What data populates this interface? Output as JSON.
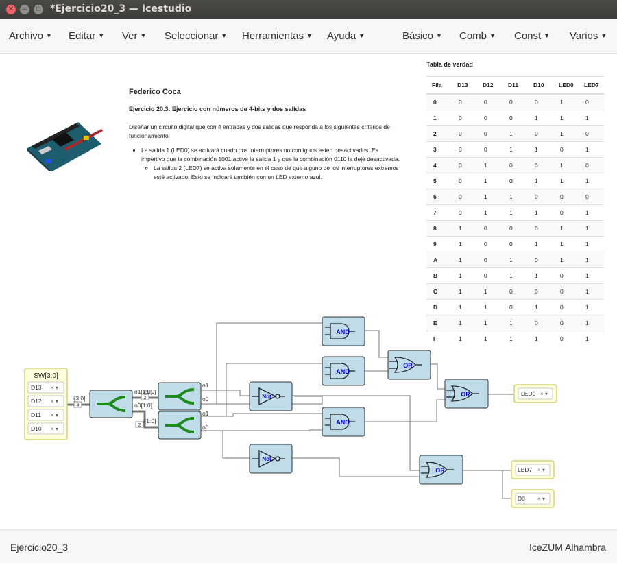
{
  "window": {
    "title": "*Ejercicio20_3 — Icestudio"
  },
  "menu": {
    "left": [
      "Archivo",
      "Editar",
      "Ver",
      "Seleccionar",
      "Herramientas",
      "Ayuda"
    ],
    "right": [
      "Básico",
      "Comb",
      "Const",
      "Varios"
    ]
  },
  "doc": {
    "author": "Federico Coca",
    "subtitle": "Ejercicio 20.3: Ejercicio con números de 4-bits y dos salidas",
    "intro": "Diseñar un circuito digital que con 4 entradas y dos salidas que responda a los siguientes criterios de funcionamiento:",
    "item1": "La salida 1 (LED0) se activará cuado dos interruptores no contiguos estén desactivados. Es impertivo que la combinación 1001 active la salida 1 y que la combinación 0110 la deje desactivada.",
    "item2": "La salida 2 (LED7) se activa solamente en el caso de que alguno de los interruptores extremos esté activado. Esto se indicará también con un LED externo azul."
  },
  "truth_table": {
    "title": "Tabla de verdad",
    "headers": [
      "Fila",
      "D13",
      "D12",
      "D11",
      "D10",
      "LED0",
      "LED7"
    ],
    "rows": [
      [
        "0",
        "0",
        "0",
        "0",
        "0",
        "1",
        "0"
      ],
      [
        "1",
        "0",
        "0",
        "0",
        "1",
        "1",
        "1"
      ],
      [
        "2",
        "0",
        "0",
        "1",
        "0",
        "1",
        "0"
      ],
      [
        "3",
        "0",
        "0",
        "1",
        "1",
        "0",
        "1"
      ],
      [
        "4",
        "0",
        "1",
        "0",
        "0",
        "1",
        "0"
      ],
      [
        "5",
        "0",
        "1",
        "0",
        "1",
        "1",
        "1"
      ],
      [
        "6",
        "0",
        "1",
        "1",
        "0",
        "0",
        "0"
      ],
      [
        "7",
        "0",
        "1",
        "1",
        "1",
        "0",
        "1"
      ],
      [
        "8",
        "1",
        "0",
        "0",
        "0",
        "1",
        "1"
      ],
      [
        "9",
        "1",
        "0",
        "0",
        "1",
        "1",
        "1"
      ],
      [
        "A",
        "1",
        "0",
        "1",
        "0",
        "1",
        "1"
      ],
      [
        "B",
        "1",
        "0",
        "1",
        "1",
        "0",
        "1"
      ],
      [
        "C",
        "1",
        "1",
        "0",
        "0",
        "0",
        "1"
      ],
      [
        "D",
        "1",
        "1",
        "0",
        "1",
        "0",
        "1"
      ],
      [
        "E",
        "1",
        "1",
        "1",
        "0",
        "0",
        "1"
      ],
      [
        "F",
        "1",
        "1",
        "1",
        "1",
        "0",
        "1"
      ]
    ]
  },
  "circuit": {
    "input_block": {
      "title": "SW[3:0]",
      "pins": [
        "D13",
        "D12",
        "D11",
        "D10"
      ]
    },
    "bus_labels": {
      "main": "i[3:0]",
      "main_width": "4",
      "split_hi_out": "o1[1:0]",
      "split_lo_out": "o0[1:0]",
      "split_hi_in": "i[1:0]",
      "split_lo_in": "i[1:0]",
      "sub_width": "2",
      "bit1": "o1",
      "bit0": "o0"
    },
    "gates": {
      "and": "AND",
      "or": "OR",
      "not": "Not"
    },
    "outputs": [
      "LED0",
      "LED7",
      "D0"
    ]
  },
  "status": {
    "left": "Ejercicio20_3",
    "right": "IceZUM Alhambra"
  },
  "colors": {
    "block_fill": "#c0dce8",
    "block_stroke": "#333333",
    "pin_fill": "#ffffdd",
    "pin_stroke": "#d4d47a",
    "splitter": "#1f8a1f",
    "gate_text": "#0000cc"
  }
}
